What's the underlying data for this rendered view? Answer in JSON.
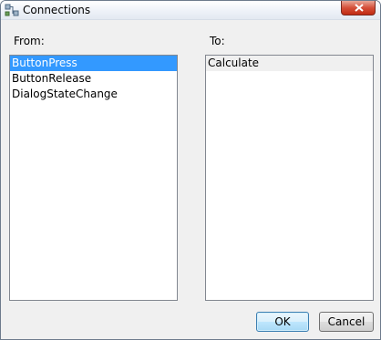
{
  "window": {
    "title": "Connections",
    "icon": "connections-icon"
  },
  "from": {
    "label": "From:",
    "items": [
      "ButtonPress",
      "ButtonRelease",
      "DialogStateChange"
    ],
    "selected_index": 0
  },
  "to": {
    "label": "To:",
    "items": [
      "Calculate"
    ],
    "selected_index": 0
  },
  "buttons": {
    "ok": "OK",
    "cancel": "Cancel"
  },
  "colors": {
    "selection": "#3399ff",
    "close_button": "#c94a36"
  }
}
